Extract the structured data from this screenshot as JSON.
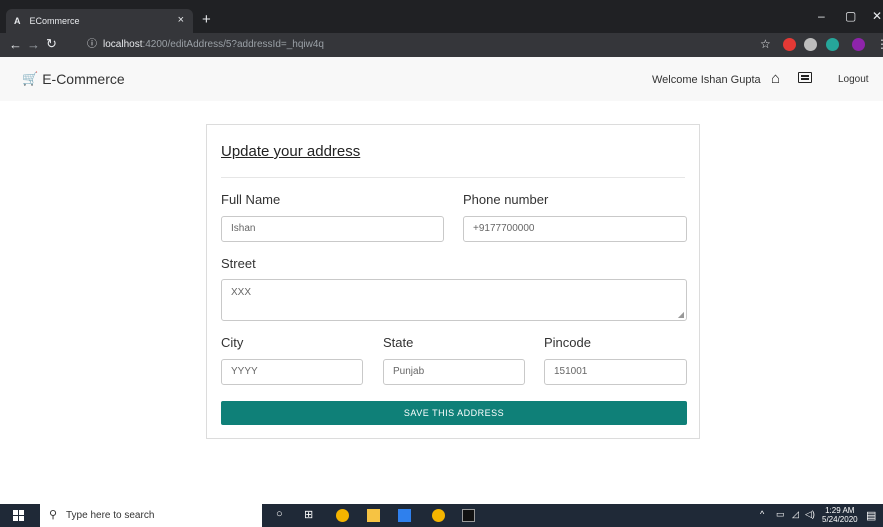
{
  "browser": {
    "tab_title": "ECommerce",
    "tab_favicon": "A",
    "tab_close": "×",
    "new_tab": "+",
    "url_host": "localhost",
    "url_path": ":4200/editAddress/5?addressId=_hqiw4q",
    "minimize": "–",
    "maximize": "▢",
    "close": "✕"
  },
  "navbar": {
    "brand": "E-Commerce",
    "welcome": "Welcome Ishan Gupta",
    "logout": "Logout"
  },
  "form": {
    "title": "Update your address",
    "full_name_label": "Full Name",
    "full_name_value": "Ishan",
    "phone_label": "Phone number",
    "phone_value": "+9177700000",
    "street_label": "Street",
    "street_value": "XXX",
    "city_label": "City",
    "city_value": "YYYY",
    "state_label": "State",
    "state_value": "Punjab",
    "pincode_label": "Pincode",
    "pincode_value": "151001",
    "save_label": "SAVE THIS ADDRESS"
  },
  "taskbar": {
    "search_placeholder": "Type here to search",
    "time": "1:29 AM",
    "date": "5/24/2020"
  },
  "colors": {
    "accent": "#0f8078",
    "navbar_bg": "#f8f8f8",
    "chrome_bg": "#202124"
  }
}
